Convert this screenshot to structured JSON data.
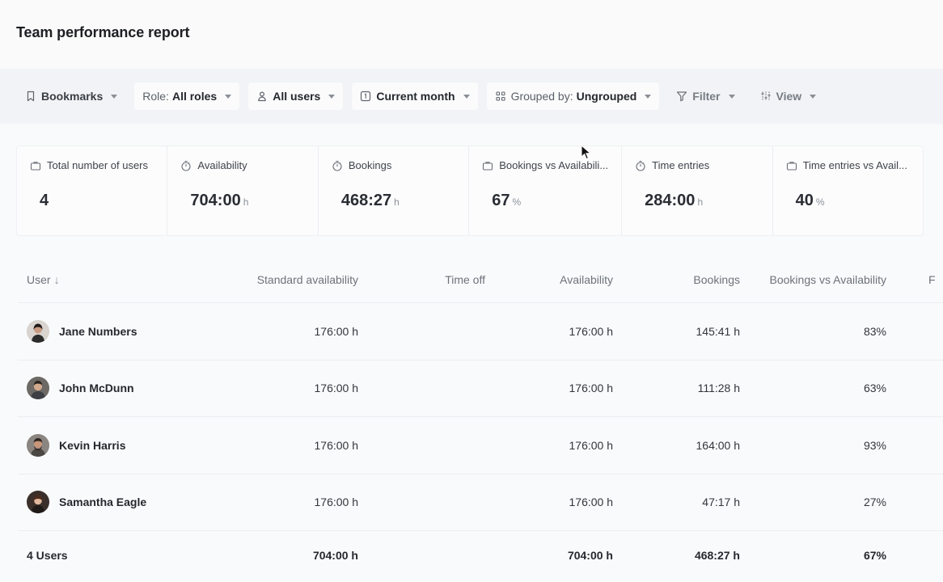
{
  "page": {
    "title": "Team performance report"
  },
  "toolbar": {
    "bookmarks": "Bookmarks",
    "role_prefix": "Role:",
    "role_value": "All roles",
    "users": "All users",
    "period": "Current month",
    "group_prefix": "Grouped by:",
    "group_value": "Ungrouped",
    "filter": "Filter",
    "view": "View"
  },
  "stats": [
    {
      "label": "Total number of users",
      "value": "4",
      "unit": "",
      "icon": "briefcase-icon"
    },
    {
      "label": "Availability",
      "value": "704:00",
      "unit": "h",
      "icon": "stopwatch-icon"
    },
    {
      "label": "Bookings",
      "value": "468:27",
      "unit": "h",
      "icon": "stopwatch-icon"
    },
    {
      "label": "Bookings vs Availabili...",
      "value": "67",
      "unit": "%",
      "icon": "briefcase-icon"
    },
    {
      "label": "Time entries",
      "value": "284:00",
      "unit": "h",
      "icon": "stopwatch-icon"
    },
    {
      "label": "Time entries vs Avail...",
      "value": "40",
      "unit": "%",
      "icon": "briefcase-icon"
    }
  ],
  "table": {
    "columns": {
      "user": "User",
      "sort_indicator": "↓",
      "standard_availability": "Standard availability",
      "time_off": "Time off",
      "availability": "Availability",
      "bookings": "Bookings",
      "bookings_vs_availability": "Bookings vs Availability",
      "more": "F"
    },
    "rows": [
      {
        "name": "Jane Numbers",
        "standard": "176:00 h",
        "time_off": "",
        "availability": "176:00 h",
        "bookings": "145:41 h",
        "bva": "83%"
      },
      {
        "name": "John McDunn",
        "standard": "176:00 h",
        "time_off": "",
        "availability": "176:00 h",
        "bookings": "111:28 h",
        "bva": "63%"
      },
      {
        "name": "Kevin Harris",
        "standard": "176:00 h",
        "time_off": "",
        "availability": "176:00 h",
        "bookings": "164:00 h",
        "bva": "93%"
      },
      {
        "name": "Samantha Eagle",
        "standard": "176:00 h",
        "time_off": "",
        "availability": "176:00 h",
        "bookings": "47:17 h",
        "bva": "27%"
      }
    ],
    "footer": {
      "label": "4 Users",
      "standard": "704:00 h",
      "time_off": "",
      "availability": "704:00 h",
      "bookings": "468:27 h",
      "bva": "67%"
    }
  },
  "colors": {
    "page_bg": "#f9fafb",
    "toolbar_bg": "#f1f3f6",
    "text_primary": "#1f2328",
    "text_muted": "#6d727a"
  }
}
